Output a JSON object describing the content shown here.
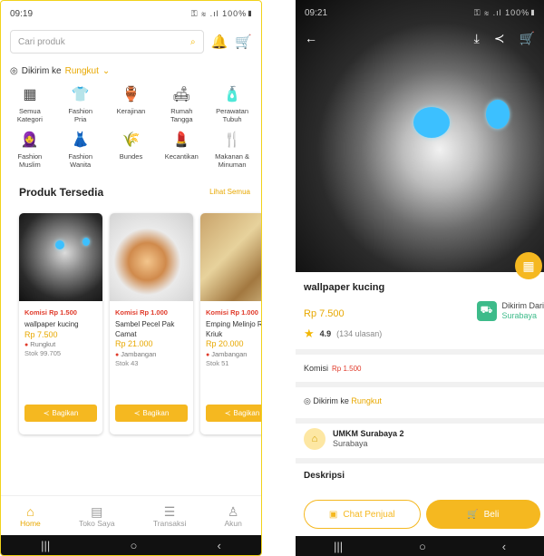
{
  "left": {
    "status": {
      "time": "09:19",
      "icons": "⚿ ≋ .ıl 100%▮"
    },
    "search": {
      "placeholder": "Cari produk"
    },
    "shipping": {
      "prefix": "Dikirim ke",
      "location": "Rungkut"
    },
    "categories": [
      {
        "label": "Semua\nKategori",
        "icon": "grid-icon",
        "glyph": "▦"
      },
      {
        "label": "Fashion\nPria",
        "icon": "shirt-icon",
        "glyph": "👕"
      },
      {
        "label": "Kerajinan",
        "icon": "craft-icon",
        "glyph": "🏺"
      },
      {
        "label": "Rumah\nTangga",
        "icon": "home-goods-icon",
        "glyph": "🛋"
      },
      {
        "label": "Perawatan\nTubuh",
        "icon": "body-care-icon",
        "glyph": "🧴"
      },
      {
        "label": "Fashion\nMuslim",
        "icon": "hijab-icon",
        "glyph": "🧕"
      },
      {
        "label": "Fashion\nWanita",
        "icon": "dress-icon",
        "glyph": "👗"
      },
      {
        "label": "Bundes",
        "icon": "leaf-icon",
        "glyph": "🌾"
      },
      {
        "label": "Kecantikan",
        "icon": "makeup-icon",
        "glyph": "💄"
      },
      {
        "label": "Makanan &\nMinuman",
        "icon": "utensils-icon",
        "glyph": "🍴"
      }
    ],
    "section": {
      "title": "Produk Tersedia",
      "more": "Lihat Semua"
    },
    "products": [
      {
        "komisi": "Komisi Rp 1.500",
        "name": "wallpaper kucing",
        "price": "Rp 7.500",
        "city": "Rungkut",
        "stock": "Stok 99.705",
        "share": "Bagikan"
      },
      {
        "komisi": "Komisi Rp 1.000",
        "name": "Sambel Pecel Pak Camat",
        "price": "Rp 21.000",
        "city": "Jambangan",
        "stock": "Stok 43",
        "share": "Bagikan"
      },
      {
        "komisi": "Komisi Rp 1.000",
        "name": "Emping Melinjo Raja Kriuk",
        "price": "Rp 20.000",
        "city": "Jambangan",
        "stock": "Stok 51",
        "share": "Bagikan"
      }
    ],
    "bottom_nav": [
      {
        "label": "Home",
        "glyph": "⌂",
        "icon": "home-icon",
        "active": true
      },
      {
        "label": "Toko Saya",
        "glyph": "▤",
        "icon": "store-icon",
        "active": false
      },
      {
        "label": "Transaksi",
        "glyph": "☰",
        "icon": "receipt-icon",
        "active": false
      },
      {
        "label": "Akun",
        "glyph": "♙",
        "icon": "user-icon",
        "active": false
      }
    ]
  },
  "right": {
    "status": {
      "time": "09:21",
      "icons": "⚿ ≋ .ıl 100%▮"
    },
    "product": {
      "name": "wallpaper kucing",
      "price": "Rp 7.500",
      "rating": "4.9",
      "reviews": "(134 ulasan)",
      "delivery_label": "Dikirim Dari",
      "delivery_city": "Surabaya",
      "komisi_label": "Komisi",
      "komisi_value": "Rp 1.500",
      "ship_prefix": "Dikirim ke",
      "ship_location": "Rungkut",
      "shop_name": "UMKM Surabaya 2",
      "shop_city": "Surabaya",
      "desc_title": "Deskripsi"
    },
    "actions": {
      "chat": "Chat Penjual",
      "buy": "Beli"
    }
  },
  "navbar": {
    "recent": "|||",
    "home": "○",
    "back": "‹"
  },
  "colors": {
    "accent": "#f5b820",
    "red": "#e03b2b",
    "green": "#3dbb8a"
  }
}
